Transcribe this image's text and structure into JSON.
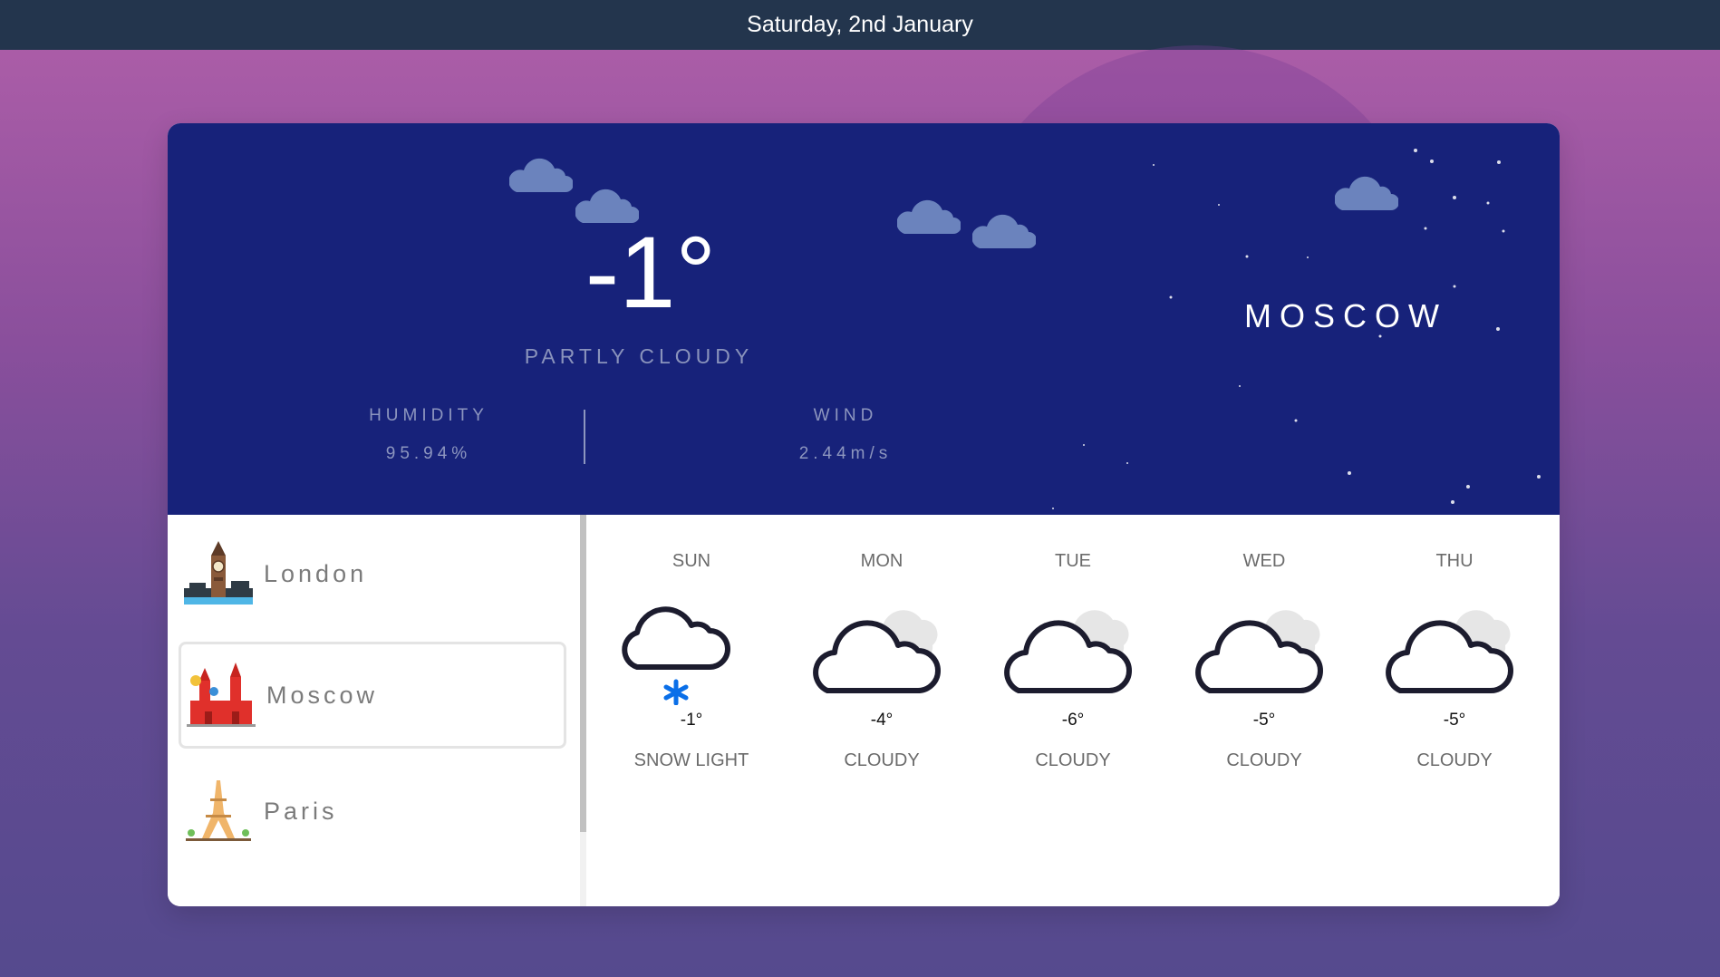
{
  "header": {
    "date": "Saturday, 2nd January"
  },
  "current": {
    "temperature": "-1°",
    "condition": "PARTLY CLOUDY",
    "humidity_label": "HUMIDITY",
    "humidity_value": "95.94%",
    "wind_label": "WIND",
    "wind_value": "2.44m/s",
    "city": "MOSCOW"
  },
  "cities": [
    {
      "name": "London",
      "icon": "big-ben-icon"
    },
    {
      "name": "Moscow",
      "icon": "kremlin-icon",
      "selected": true
    },
    {
      "name": "Paris",
      "icon": "eiffel-tower-icon"
    }
  ],
  "forecast": [
    {
      "day": "SUN",
      "temp": "-1°",
      "desc": "SNOW LIGHT",
      "icon": "snow-cloud-icon"
    },
    {
      "day": "MON",
      "temp": "-4°",
      "desc": "CLOUDY",
      "icon": "cloudy-icon"
    },
    {
      "day": "TUE",
      "temp": "-6°",
      "desc": "CLOUDY",
      "icon": "cloudy-icon"
    },
    {
      "day": "WED",
      "temp": "-5°",
      "desc": "CLOUDY",
      "icon": "cloudy-icon"
    },
    {
      "day": "THU",
      "temp": "-5°",
      "desc": "CLOUDY",
      "icon": "cloudy-icon"
    }
  ],
  "colors": {
    "topbar": "#23354d",
    "hero": "#17227a",
    "cloud": "#6b83bd",
    "snowflake": "#0a6fe8"
  }
}
